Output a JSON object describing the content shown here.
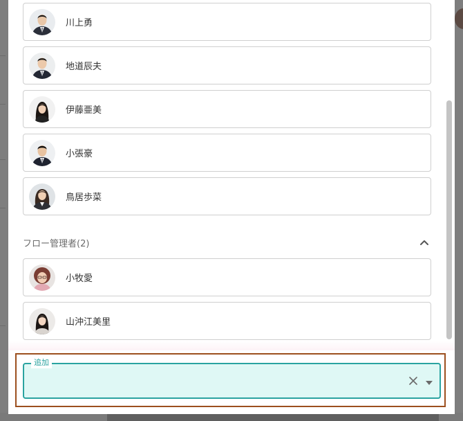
{
  "members_top": [
    {
      "name": "川上勇",
      "avatar": "male-suit-avatar"
    },
    {
      "name": "地道辰夫",
      "avatar": "male-suit-avatar"
    },
    {
      "name": "伊藤亜美",
      "avatar": "female-longhair-avatar"
    },
    {
      "name": "小張豪",
      "avatar": "male-suit-avatar"
    },
    {
      "name": "鳥居歩菜",
      "avatar": "female-suit-avatar"
    }
  ],
  "section": {
    "title": "フロー管理者(2)",
    "toggle_icon": "chevron-up-icon"
  },
  "members_admin": [
    {
      "name": "小牧愛",
      "avatar": "female-curly-avatar"
    },
    {
      "name": "山沖江美里",
      "avatar": "female-longhair-avatar"
    }
  ],
  "add_field": {
    "label": "追加",
    "value": "",
    "clear_icon": "close-icon",
    "dropdown_icon": "caret-down-icon"
  },
  "colors": {
    "accent": "#2aa3a0",
    "highlight_border": "#9c4f1e",
    "field_fill": "#dff8f5"
  }
}
